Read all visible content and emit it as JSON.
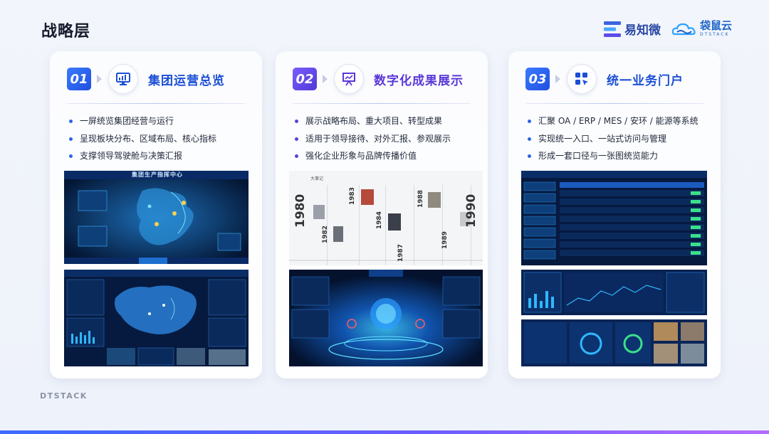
{
  "page": {
    "title": "战略层",
    "footer_brand": "DTSTACK",
    "logo_a": "易知微",
    "logo_b": "袋鼠云",
    "logo_b_sub": "DTSTACK"
  },
  "cards": [
    {
      "number": "01",
      "title": "集团运营总览",
      "icon": "monitor-dashboard-icon",
      "bullets": [
        "一屏统览集团经营与运行",
        "呈现板块分布、区域布局、核心指标",
        "支撑领导驾驶舱与决策汇报"
      ],
      "screens": [
        "集团生产指挥中心"
      ]
    },
    {
      "number": "02",
      "title": "数字化成果展示",
      "icon": "presentation-chart-icon",
      "bullets": [
        "展示战略布局、重大项目、转型成果",
        "适用于领导接待、对外汇报、参观展示",
        "强化企业形象与品牌传播价值"
      ],
      "timeline": {
        "header": "大事记",
        "years": [
          "1980",
          "1982",
          "1983",
          "1984",
          "1987",
          "1988",
          "1989",
          "1990"
        ]
      }
    },
    {
      "number": "03",
      "title": "统一业务门户",
      "icon": "app-grid-cursor-icon",
      "bullets": [
        "汇聚 OA / ERP / MES / 安环 / 能源等系统",
        "实现统一入口、一站式访问与管理",
        "形成一套口径与一张图统览能力"
      ]
    }
  ],
  "colors": {
    "accent_blue": "#1c4fd6",
    "accent_purple": "#5a38d8",
    "dashboard_bg": "#06183d",
    "dashboard_line": "#2fb8ff"
  }
}
